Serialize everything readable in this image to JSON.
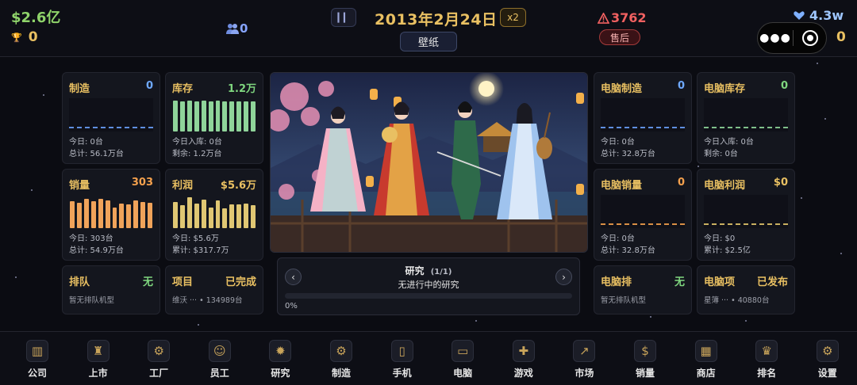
{
  "top": {
    "money": "$2.6亿",
    "trophies": "0",
    "employees": "0",
    "date": "2013年2月24日",
    "speed": "x2",
    "wallpaper_label": "壁纸",
    "warnings": "3762",
    "after_sales_label": "售后",
    "fans": "4.3w",
    "right_zero": "0"
  },
  "phone_cards": [
    {
      "title": "制造",
      "value": "0",
      "value_color": "#6fa9ff",
      "line1": "今日: 0台",
      "line2": "总计: 56.1万台",
      "chart": "dash",
      "chart_color": "#5f8fe0"
    },
    {
      "title": "库存",
      "value": "1.2万",
      "value_color": "#7fd67f",
      "line1": "今日入库: 0台",
      "line2": "剩余: 1.2万台",
      "chart": "bars",
      "chart_color": "#8fd49a",
      "bars": [
        0.92,
        0.9,
        0.92,
        0.9,
        0.92,
        0.9,
        0.92,
        0.9,
        0.9,
        0.9,
        0.9,
        0.9
      ]
    },
    {
      "title": "销量",
      "value": "303",
      "value_color": "#f5a14d",
      "line1": "今日: 303台",
      "line2": "总计: 54.9万台",
      "chart": "bars",
      "chart_color": "#f0a35a",
      "bars": [
        0.82,
        0.76,
        0.87,
        0.8,
        0.87,
        0.83,
        0.62,
        0.74,
        0.72,
        0.83,
        0.78,
        0.76
      ]
    },
    {
      "title": "利润",
      "value": "$5.6万",
      "value_color": "#e9c062",
      "line1": "今日: $5.6万",
      "line2": "累计: $317.7万",
      "chart": "bars",
      "chart_color": "#e0c773",
      "bars": [
        0.78,
        0.68,
        0.93,
        0.75,
        0.85,
        0.62,
        0.83,
        0.6,
        0.72,
        0.71,
        0.74,
        0.7
      ]
    }
  ],
  "phone_small": [
    {
      "title": "排队",
      "value": "无",
      "value_color": "#7fd67f",
      "sub": "暂无排队机型"
    },
    {
      "title": "项目",
      "value": "已完成",
      "value_color": "#e9c062",
      "sub": "维沃 ··· • 134989台"
    }
  ],
  "pc_cards": [
    {
      "title": "电脑制造",
      "value": "0",
      "value_color": "#6fa9ff",
      "line1": "今日: 0台",
      "line2": "总计: 32.8万台",
      "chart": "dash",
      "chart_color": "#5f8fe0"
    },
    {
      "title": "电脑库存",
      "value": "0",
      "value_color": "#7fd67f",
      "line1": "今日入库: 0台",
      "line2": "剩余: 0台",
      "chart": "dash",
      "chart_color": "#7fbf8a"
    },
    {
      "title": "电脑销量",
      "value": "0",
      "value_color": "#f5a14d",
      "line1": "今日: 0台",
      "line2": "总计: 32.8万台",
      "chart": "dash",
      "chart_color": "#d98f45"
    },
    {
      "title": "电脑利润",
      "value": "$0",
      "value_color": "#e9c062",
      "line1": "今日: $0",
      "line2": "累计: $2.5亿",
      "chart": "dash",
      "chart_color": "#c9b060"
    }
  ],
  "pc_small": [
    {
      "title": "电脑排",
      "value": "无",
      "value_color": "#7fd67f",
      "sub": "暂无排队机型"
    },
    {
      "title": "电脑项",
      "value": "已发布",
      "value_color": "#e9c062",
      "sub": "星簿 ··· • 40880台"
    }
  ],
  "research": {
    "title": "研究",
    "count": "(1/1)",
    "status": "无进行中的研究",
    "progress_label": "0%",
    "progress": 0
  },
  "nav": [
    {
      "label": "公司",
      "icon": "company-icon",
      "glyph": "▥"
    },
    {
      "label": "上市",
      "icon": "listing-icon",
      "glyph": "♜"
    },
    {
      "label": "工厂",
      "icon": "factory-icon",
      "glyph": "⚙"
    },
    {
      "label": "员工",
      "icon": "employee-icon",
      "glyph": "☺"
    },
    {
      "label": "研究",
      "icon": "research-icon",
      "glyph": "✹"
    },
    {
      "label": "制造",
      "icon": "manufacture-icon",
      "glyph": "⚙"
    },
    {
      "label": "手机",
      "icon": "phone-icon",
      "glyph": "▯"
    },
    {
      "label": "电脑",
      "icon": "laptop-icon",
      "glyph": "▭"
    },
    {
      "label": "游戏",
      "icon": "gamepad-icon",
      "glyph": "✚"
    },
    {
      "label": "市场",
      "icon": "market-icon",
      "glyph": "↗"
    },
    {
      "label": "销量",
      "icon": "sales-icon",
      "glyph": "$"
    },
    {
      "label": "商店",
      "icon": "store-icon",
      "glyph": "▦"
    },
    {
      "label": "排名",
      "icon": "ranking-icon",
      "glyph": "♛"
    },
    {
      "label": "设置",
      "icon": "settings-icon",
      "glyph": "⚙"
    }
  ]
}
